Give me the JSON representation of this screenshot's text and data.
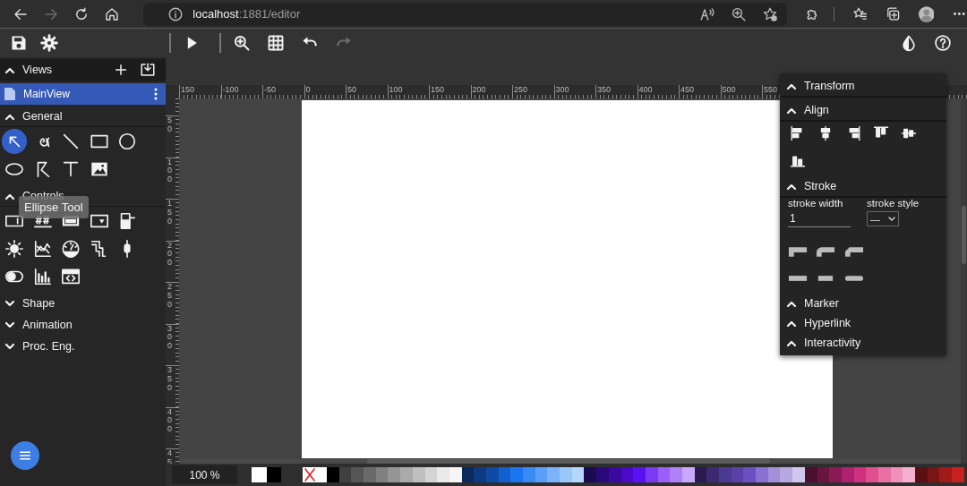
{
  "browser": {
    "nav": [
      {
        "kind": "back",
        "disabled": false
      },
      {
        "kind": "forward",
        "disabled": true
      },
      {
        "kind": "reload",
        "disabled": false
      },
      {
        "kind": "home",
        "disabled": false
      }
    ],
    "address": "**localhost**:1881/editor"
  },
  "toolbar": {
    "left": [
      {
        "kind": "save",
        "disabled": false
      },
      {
        "kind": "settings",
        "disabled": false
      }
    ],
    "center": [
      {
        "kind": "play",
        "disabled": false
      },
      {
        "kind": "zoom",
        "disabled": false
      },
      {
        "kind": "grid",
        "disabled": false
      },
      {
        "kind": "undo",
        "disabled": false
      },
      {
        "kind": "redo",
        "disabled": true
      }
    ],
    "right": [
      {
        "kind": "contrast",
        "disabled": false
      },
      {
        "kind": "help",
        "disabled": false
      }
    ]
  },
  "sidebar": {
    "views": {
      "title": "Views",
      "expanded": true,
      "items": [
        {
          "label": "MainView",
          "selected": true
        }
      ]
    },
    "sections": [
      {
        "title": "General",
        "expanded": true,
        "tools": [
          {
            "kind": "pointer",
            "selected": true
          },
          {
            "kind": "path",
            "selected": false
          },
          {
            "kind": "line",
            "selected": false
          },
          {
            "kind": "rect",
            "selected": false
          },
          {
            "kind": "circle",
            "selected": false
          },
          {
            "kind": "ellipse",
            "selected": false
          },
          {
            "kind": "polyline",
            "selected": false
          },
          {
            "kind": "text",
            "selected": false
          },
          {
            "kind": "image",
            "selected": false
          }
        ]
      },
      {
        "title": "Controls",
        "expanded": true,
        "tools": [
          {
            "kind": "input",
            "selected": false
          },
          {
            "kind": "value",
            "selected": false
          },
          {
            "kind": "button",
            "selected": false
          },
          {
            "kind": "select",
            "selected": false
          },
          {
            "kind": "level",
            "selected": false
          },
          {
            "kind": "sun",
            "selected": false
          },
          {
            "kind": "chart",
            "selected": false
          },
          {
            "kind": "gauge",
            "selected": false
          },
          {
            "kind": "pipe",
            "selected": false
          },
          {
            "kind": "slider",
            "selected": false
          },
          {
            "kind": "switch",
            "selected": false
          },
          {
            "kind": "bars",
            "selected": false
          },
          {
            "kind": "iframe",
            "selected": false
          }
        ]
      },
      {
        "title": "Shape",
        "expanded": false
      },
      {
        "title": "Animation",
        "expanded": false
      },
      {
        "title": "Proc. Eng.",
        "expanded": false
      }
    ]
  },
  "tooltip": "Ellipse Tool",
  "rulers": {
    "horizontal": [
      "150",
      "-100",
      "-50",
      "0",
      "50",
      "100",
      "150",
      "200",
      "250",
      "300",
      "350",
      "400",
      "450",
      "500",
      "550"
    ],
    "vertical": [
      "50",
      "100",
      "150",
      "200",
      "250",
      "300",
      "350",
      "400",
      "45"
    ]
  },
  "properties": {
    "sections": [
      {
        "title": "Transform",
        "expanded": true
      },
      {
        "title": "Align",
        "expanded": true,
        "buttons": [
          {
            "kind": "left"
          },
          {
            "kind": "center"
          },
          {
            "kind": "right"
          },
          {
            "kind": "top"
          },
          {
            "kind": "middle"
          },
          {
            "kind": "bottom"
          }
        ]
      },
      {
        "title": "Stroke",
        "expanded": true,
        "stroke_width": {
          "label": "stroke width",
          "value": "1"
        },
        "stroke_style": {
          "label": "stroke style",
          "value": "—"
        },
        "buttons": [
          {
            "kind": "miter"
          },
          {
            "kind": "round-join"
          },
          {
            "kind": "bevel"
          },
          {
            "kind": "butt"
          },
          {
            "kind": "square"
          },
          {
            "kind": "round-cap"
          }
        ]
      },
      {
        "title": "Marker",
        "expanded": true
      },
      {
        "title": "Hyperlink",
        "expanded": true
      },
      {
        "title": "Interactivity",
        "expanded": true
      }
    ]
  },
  "statusbar": {
    "zoom": "100 %",
    "current_colors": [
      {
        "color": "#ffffff"
      },
      {
        "color": "#000000"
      }
    ],
    "palette": [
      {
        "kind": "none"
      },
      {
        "color": "#000000"
      },
      {
        "color": "#404040"
      },
      {
        "color": "#555555"
      },
      {
        "color": "#6a6a6a"
      },
      {
        "color": "#808080"
      },
      {
        "color": "#959595"
      },
      {
        "color": "#aaaaaa"
      },
      {
        "color": "#bfbfbf"
      },
      {
        "color": "#d4d4d4"
      },
      {
        "color": "#e9e9e9"
      },
      {
        "color": "#f5f5f5"
      },
      {
        "color": "#0a2a5c"
      },
      {
        "color": "#0d3a80"
      },
      {
        "color": "#0f4aa5"
      },
      {
        "color": "#1260d0"
      },
      {
        "color": "#1a75f0"
      },
      {
        "color": "#3a8af5"
      },
      {
        "color": "#5a9ff7"
      },
      {
        "color": "#7ab3f8"
      },
      {
        "color": "#9ac8fa"
      },
      {
        "color": "#b6d6fb"
      },
      {
        "color": "#1a0a50"
      },
      {
        "color": "#2a0a78"
      },
      {
        "color": "#3a0aa0"
      },
      {
        "color": "#4a0ac8"
      },
      {
        "color": "#5a10f0"
      },
      {
        "color": "#7a3af5"
      },
      {
        "color": "#9a5ff7"
      },
      {
        "color": "#b080f8"
      },
      {
        "color": "#c8a8fa"
      },
      {
        "color": "#2a1a50"
      },
      {
        "color": "#3a2a70"
      },
      {
        "color": "#4a3a90"
      },
      {
        "color": "#5a40a8"
      },
      {
        "color": "#6a50c0"
      },
      {
        "color": "#8a70d0"
      },
      {
        "color": "#a090d8"
      },
      {
        "color": "#b8a8e0"
      },
      {
        "color": "#d0c8ec"
      },
      {
        "color": "#4a1030"
      },
      {
        "color": "#6a1540"
      },
      {
        "color": "#8a1a55"
      },
      {
        "color": "#b02070"
      },
      {
        "color": "#d03080"
      },
      {
        "color": "#e0508f"
      },
      {
        "color": "#e870a5"
      },
      {
        "color": "#f090bb"
      },
      {
        "color": "#f5b0d0"
      },
      {
        "color": "#5a1010"
      },
      {
        "color": "#7a1515"
      },
      {
        "color": "#a01a1a"
      },
      {
        "color": "#c82020"
      }
    ]
  }
}
